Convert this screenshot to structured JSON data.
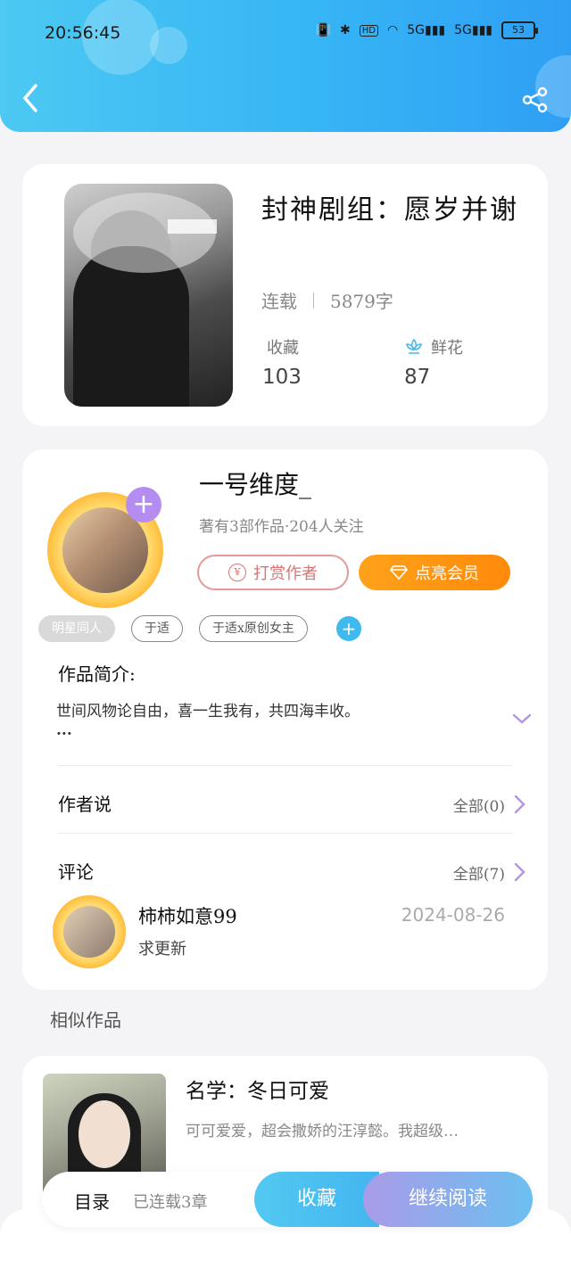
{
  "status_bar": {
    "time": "20:56:45",
    "network": "5G",
    "battery": "53"
  },
  "book": {
    "title": "封神剧组：愿岁并谢",
    "status": "连载",
    "word_count": "5879字",
    "favorites_label": "收藏",
    "favorites_count": "103",
    "flowers_label": "鲜花",
    "flowers_count": "87"
  },
  "author": {
    "name": "一号维度_",
    "summary": "著有3部作品·204人关注",
    "tip_label": "打赏作者",
    "vip_label": "点亮会员"
  },
  "tags": [
    "明星同人",
    "于适",
    "于适x原创女主"
  ],
  "intro": {
    "heading": "作品简介:",
    "text": "世间风物论自由，喜一生我有，共四海丰收。",
    "ellipsis": "..."
  },
  "author_says": {
    "heading": "作者说",
    "link": "全部(0)"
  },
  "comments": {
    "heading": "评论",
    "link": "全部(7)",
    "items": [
      {
        "user": "柿柿如意99",
        "date": "2024-08-26",
        "text": "求更新"
      }
    ]
  },
  "similar": {
    "heading": "相似作品",
    "items": [
      {
        "title": "名学：冬日可爱",
        "desc": "可可爱爱，超会撒娇的汪淳懿。我超级…"
      }
    ]
  },
  "bottom_bar": {
    "toc_label": "目录",
    "toc_sub": "已连载3章",
    "collect_label": "收藏",
    "read_label": "继续阅读"
  },
  "colors": {
    "header": "#36b5f5",
    "vip": "#ff8a0a",
    "tip": "#d77575",
    "accent": "#b58cf2"
  }
}
